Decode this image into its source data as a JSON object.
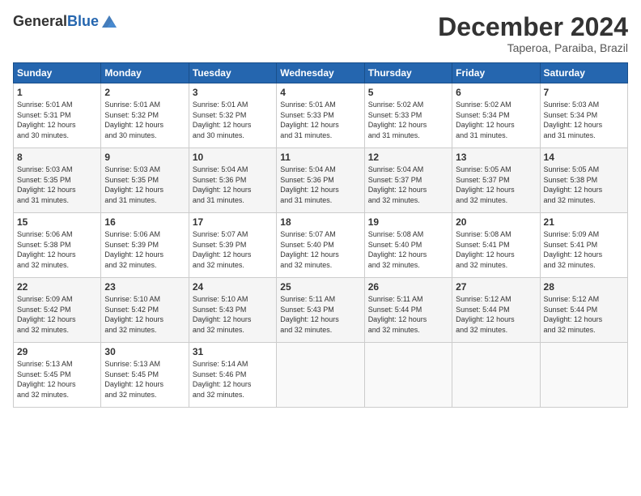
{
  "header": {
    "logo_line1": "General",
    "logo_line2": "Blue",
    "month": "December 2024",
    "location": "Taperoa, Paraiba, Brazil"
  },
  "days_of_week": [
    "Sunday",
    "Monday",
    "Tuesday",
    "Wednesday",
    "Thursday",
    "Friday",
    "Saturday"
  ],
  "weeks": [
    [
      {
        "day": "1",
        "info": "Sunrise: 5:01 AM\nSunset: 5:31 PM\nDaylight: 12 hours\nand 30 minutes."
      },
      {
        "day": "2",
        "info": "Sunrise: 5:01 AM\nSunset: 5:32 PM\nDaylight: 12 hours\nand 30 minutes."
      },
      {
        "day": "3",
        "info": "Sunrise: 5:01 AM\nSunset: 5:32 PM\nDaylight: 12 hours\nand 30 minutes."
      },
      {
        "day": "4",
        "info": "Sunrise: 5:01 AM\nSunset: 5:33 PM\nDaylight: 12 hours\nand 31 minutes."
      },
      {
        "day": "5",
        "info": "Sunrise: 5:02 AM\nSunset: 5:33 PM\nDaylight: 12 hours\nand 31 minutes."
      },
      {
        "day": "6",
        "info": "Sunrise: 5:02 AM\nSunset: 5:34 PM\nDaylight: 12 hours\nand 31 minutes."
      },
      {
        "day": "7",
        "info": "Sunrise: 5:03 AM\nSunset: 5:34 PM\nDaylight: 12 hours\nand 31 minutes."
      }
    ],
    [
      {
        "day": "8",
        "info": "Sunrise: 5:03 AM\nSunset: 5:35 PM\nDaylight: 12 hours\nand 31 minutes."
      },
      {
        "day": "9",
        "info": "Sunrise: 5:03 AM\nSunset: 5:35 PM\nDaylight: 12 hours\nand 31 minutes."
      },
      {
        "day": "10",
        "info": "Sunrise: 5:04 AM\nSunset: 5:36 PM\nDaylight: 12 hours\nand 31 minutes."
      },
      {
        "day": "11",
        "info": "Sunrise: 5:04 AM\nSunset: 5:36 PM\nDaylight: 12 hours\nand 31 minutes."
      },
      {
        "day": "12",
        "info": "Sunrise: 5:04 AM\nSunset: 5:37 PM\nDaylight: 12 hours\nand 32 minutes."
      },
      {
        "day": "13",
        "info": "Sunrise: 5:05 AM\nSunset: 5:37 PM\nDaylight: 12 hours\nand 32 minutes."
      },
      {
        "day": "14",
        "info": "Sunrise: 5:05 AM\nSunset: 5:38 PM\nDaylight: 12 hours\nand 32 minutes."
      }
    ],
    [
      {
        "day": "15",
        "info": "Sunrise: 5:06 AM\nSunset: 5:38 PM\nDaylight: 12 hours\nand 32 minutes."
      },
      {
        "day": "16",
        "info": "Sunrise: 5:06 AM\nSunset: 5:39 PM\nDaylight: 12 hours\nand 32 minutes."
      },
      {
        "day": "17",
        "info": "Sunrise: 5:07 AM\nSunset: 5:39 PM\nDaylight: 12 hours\nand 32 minutes."
      },
      {
        "day": "18",
        "info": "Sunrise: 5:07 AM\nSunset: 5:40 PM\nDaylight: 12 hours\nand 32 minutes."
      },
      {
        "day": "19",
        "info": "Sunrise: 5:08 AM\nSunset: 5:40 PM\nDaylight: 12 hours\nand 32 minutes."
      },
      {
        "day": "20",
        "info": "Sunrise: 5:08 AM\nSunset: 5:41 PM\nDaylight: 12 hours\nand 32 minutes."
      },
      {
        "day": "21",
        "info": "Sunrise: 5:09 AM\nSunset: 5:41 PM\nDaylight: 12 hours\nand 32 minutes."
      }
    ],
    [
      {
        "day": "22",
        "info": "Sunrise: 5:09 AM\nSunset: 5:42 PM\nDaylight: 12 hours\nand 32 minutes."
      },
      {
        "day": "23",
        "info": "Sunrise: 5:10 AM\nSunset: 5:42 PM\nDaylight: 12 hours\nand 32 minutes."
      },
      {
        "day": "24",
        "info": "Sunrise: 5:10 AM\nSunset: 5:43 PM\nDaylight: 12 hours\nand 32 minutes."
      },
      {
        "day": "25",
        "info": "Sunrise: 5:11 AM\nSunset: 5:43 PM\nDaylight: 12 hours\nand 32 minutes."
      },
      {
        "day": "26",
        "info": "Sunrise: 5:11 AM\nSunset: 5:44 PM\nDaylight: 12 hours\nand 32 minutes."
      },
      {
        "day": "27",
        "info": "Sunrise: 5:12 AM\nSunset: 5:44 PM\nDaylight: 12 hours\nand 32 minutes."
      },
      {
        "day": "28",
        "info": "Sunrise: 5:12 AM\nSunset: 5:44 PM\nDaylight: 12 hours\nand 32 minutes."
      }
    ],
    [
      {
        "day": "29",
        "info": "Sunrise: 5:13 AM\nSunset: 5:45 PM\nDaylight: 12 hours\nand 32 minutes."
      },
      {
        "day": "30",
        "info": "Sunrise: 5:13 AM\nSunset: 5:45 PM\nDaylight: 12 hours\nand 32 minutes."
      },
      {
        "day": "31",
        "info": "Sunrise: 5:14 AM\nSunset: 5:46 PM\nDaylight: 12 hours\nand 32 minutes."
      },
      {
        "day": "",
        "info": ""
      },
      {
        "day": "",
        "info": ""
      },
      {
        "day": "",
        "info": ""
      },
      {
        "day": "",
        "info": ""
      }
    ]
  ]
}
